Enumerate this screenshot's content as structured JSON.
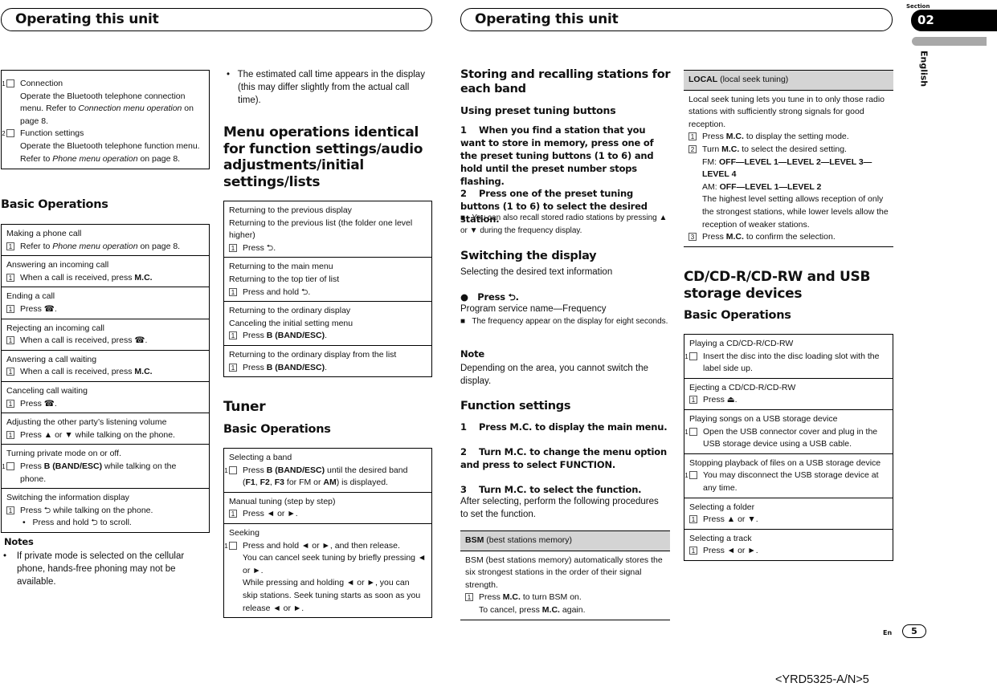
{
  "header": {
    "left_title": "Operating this unit",
    "right_title": "Operating this unit",
    "section_label": "Section",
    "section_number": "02",
    "language": "English"
  },
  "col1": {
    "menu_box": [
      {
        "num": "1",
        "title": "Connection",
        "text": "Operate the Bluetooth telephone connection menu. Refer to ",
        "ref": "Connection menu operation",
        "tail": " on page 8."
      },
      {
        "num": "2",
        "title": "Function settings",
        "text": "Operate the Bluetooth telephone function menu. Refer to ",
        "ref": "Phone menu operation",
        "tail": " on page 8."
      }
    ],
    "heading": "Basic Operations",
    "ops": {
      "c0": {
        "title": "Making a phone call",
        "pre": "Refer to ",
        "ref": "Phone menu operation",
        "post": " on page 8."
      },
      "c1": {
        "title": "Answering an incoming call",
        "pre": "When a call is received, press ",
        "key": "M.C."
      },
      "c2": {
        "title": "Ending a call",
        "pre": "Press ",
        "icon": "☎",
        "post": "."
      },
      "c3": {
        "title": "Rejecting an incoming call",
        "pre": "When a call is received, press ",
        "icon": "☎",
        "post": "."
      },
      "c4": {
        "title": "Answering a call waiting",
        "pre": "When a call is received, press ",
        "key": "M.C."
      },
      "c5": {
        "title": "Canceling call waiting",
        "pre": "Press ",
        "icon": "☎",
        "post": "."
      },
      "c6": {
        "title": "Adjusting the other party’s listening volume",
        "text": "Press ▲ or ▼ while talking on the phone."
      },
      "c7": {
        "title": "Turning private mode on or off.",
        "pre": "Press ",
        "key": "B (BAND/ESC)",
        "post": " while talking on the phone."
      },
      "c8": {
        "title": "Switching the information display",
        "pre": "Press ",
        "icon": "⮌",
        "post": " while talking on the phone.",
        "bullet_pre": "Press and hold ",
        "bullet_post": " to scroll."
      }
    },
    "notes_heading": "Notes",
    "notes": "If private mode is selected on the cellular phone, hands-free phoning may not be available."
  },
  "col2": {
    "note2": "The estimated call time appears in the display (this may differ slightly from the actual call time).",
    "menu_heading": "Menu operations identical for function settings/audio adjustments/initial settings/lists",
    "menu_ops": {
      "m0": {
        "l1": "Returning to the previous display",
        "l2": "Returning to the previous list (the folder one level higher)",
        "pre": "Press ",
        "icon": "⮌",
        "post": "."
      },
      "m1": {
        "l1": "Returning to the main menu",
        "l2": "Returning to the top tier of list",
        "pre": "Press and hold ",
        "icon": "⮌",
        "post": "."
      },
      "m2": {
        "l1": "Returning to the ordinary display",
        "l2": "Canceling the initial setting menu",
        "pre": "Press ",
        "key": "B (BAND/ESC)",
        "post": "."
      },
      "m3": {
        "l1": "Returning to the ordinary display from the list",
        "pre": "Press ",
        "key": "B (BAND/ESC)",
        "post": "."
      }
    },
    "tuner_heading": "Tuner",
    "tuner_sub": "Basic Operations",
    "tuner_ops": {
      "t0": {
        "title": "Selecting a band",
        "pre": "Press ",
        "key": "B (BAND/ESC)",
        "post": " until the desired band",
        "l2a": "(",
        "f1": "F1",
        "f2": "F2",
        "f3": "F3",
        "mid": " for FM or ",
        "am": "AM",
        "l2b": ") is displayed."
      },
      "t1": {
        "title": "Manual tuning (step by step)",
        "text": "Press ◄ or ►."
      },
      "t2": {
        "title": "Seeking",
        "l1": "Press and hold ◄ or ►, and then release.",
        "l2": "You can cancel seek tuning by briefly pressing ◄ or ►.",
        "l3": "While pressing and holding ◄ or ►, you can skip stations. Seek tuning starts as soon as you release ◄ or ►."
      }
    }
  },
  "col3": {
    "heading": "Storing and recalling stations for each band",
    "sub": "Using preset tuning buttons",
    "step1": "1    When you find a station that you want to store in memory, press one of the preset tuning buttons (1 to 6) and hold until the preset number stops flashing.",
    "step2": "2    Press one of the preset tuning buttons (1 to 6) to select the desired station.",
    "step2_note": "You can also recall stored radio stations by pressing ▲ or ▼ during the frequency display.",
    "switch_heading": "Switching the display",
    "switch_text": "Selecting the desired text information",
    "press_label": "Press ⮌.",
    "switch_seq": "Program service name—Frequency",
    "switch_note": "The frequency appear on the display for eight seconds.",
    "note_heading": "Note",
    "note_text": "Depending on the area, you cannot switch the display.",
    "func_heading": "Function settings",
    "func_step1": "1    Press M.C. to display the main menu.",
    "func_step2": "2    Turn M.C. to change the menu option and press to select FUNCTION.",
    "func_step3": "3    Turn M.C. to select the function.",
    "func_text": "After selecting, perform the following procedures to set the function.",
    "bsm_key": "BSM",
    "bsm_desc": " (best stations memory)",
    "bsm_text": "BSM (best stations memory) automatically stores the six strongest stations in the order of their signal strength.",
    "bsm_pre": "Press ",
    "bsm_mc": "M.C.",
    "bsm_post": " to turn BSM on.",
    "bsm_cancel_pre": "To cancel, press ",
    "bsm_cancel_post": " again."
  },
  "col4": {
    "local_key": "LOCAL",
    "local_desc": " (local seek tuning)",
    "local_text": "Local seek tuning lets you tune in to only those radio stations with sufficiently strong signals for good reception.",
    "s1_pre": "Press ",
    "mc": "M.C.",
    "s1_post": " to display the setting mode.",
    "s2_pre": "Turn ",
    "s2_post": " to select the desired setting.",
    "fm_label": "FM: ",
    "fm_levels": "OFF—LEVEL 1—LEVEL 2—LEVEL 3—LEVEL 4",
    "am_label": "AM: ",
    "am_levels": "OFF—LEVEL 1—LEVEL 2",
    "level_note": "The highest level setting allows reception of only the strongest stations, while lower levels allow the reception of weaker stations.",
    "s3_pre": "Press ",
    "s3_post": " to confirm the selection.",
    "cd_heading": "CD/CD-R/CD-RW and USB storage devices",
    "cd_sub": "Basic Operations",
    "cd_ops": {
      "d0": {
        "title": "Playing a CD/CD-R/CD-RW",
        "text": "Insert the disc into the disc loading slot with the label side up."
      },
      "d1": {
        "title": "Ejecting a CD/CD-R/CD-RW",
        "text": "Press ⏏."
      },
      "d2": {
        "title": "Playing songs on a USB storage device",
        "text": "Open the USB connector cover and plug in the USB storage device using a USB cable."
      },
      "d3": {
        "title": "Stopping playback of files on a USB storage device",
        "text": "You may disconnect the USB storage device at any time."
      },
      "d4": {
        "title": "Selecting a folder",
        "text": "Press ▲ or ▼."
      },
      "d5": {
        "title": "Selecting a track",
        "text": "Press ◄ or ►."
      }
    }
  },
  "footer": {
    "lang_code": "En",
    "page_number": "5",
    "doc_code": "<YRD5325-A/N>5"
  }
}
